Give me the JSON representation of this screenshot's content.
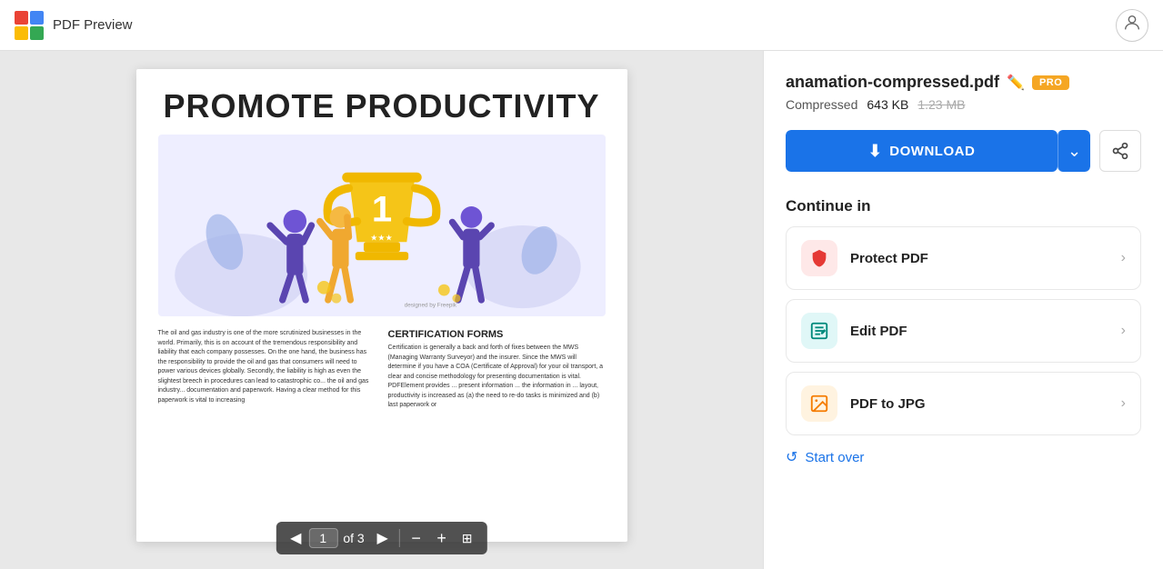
{
  "header": {
    "title": "PDF Preview",
    "logo_cells": [
      "red",
      "blue",
      "yellow",
      "green"
    ]
  },
  "pdf": {
    "title": "PROMOTE PRODUCTIVITY",
    "body_left": "The oil and gas industry is one of the more scrutinized businesses in the world. Primarily, this is on account of the tremendous responsibility and liability that each company possesses. On the one hand, the business has the responsibility to provide the oil and gas that consumers will need to power various devices globally. Secondly, the liability is high as even the slightest breech in procedures can lead to catastrophic co... the oil and gas industry... documentation and paperwork. Having a clear method for this paperwork is vital to increasing",
    "section_title": "CERTIFICATION FORMS",
    "body_right": "Certification is generally a back and forth of fixes between the MWS (Managing Warranty Surveyor) and the insurer. Since the MWS will determine if you have a COA (Certificate of Approval) for your oil transport, a clear and concise methodology for presenting documentation is vital. PDFElement provides ... present information ... the information in ... layout, productivity is increased as (a) the need to re-do tasks is minimized and (b) last paperwork or",
    "current_page": "1",
    "total_pages": "3",
    "of_text": "of 3"
  },
  "sidebar": {
    "file_name": "anamation-compressed.pdf",
    "status": "Compressed",
    "size": "643 KB",
    "original_size": "1.23 MB",
    "pro_badge": "PRO",
    "download_label": "DOWNLOAD",
    "continue_label": "Continue in",
    "tools": [
      {
        "name": "Protect PDF",
        "icon_type": "red",
        "icon": "🛡"
      },
      {
        "name": "Edit PDF",
        "icon_type": "teal",
        "icon": "✏"
      },
      {
        "name": "PDF to JPG",
        "icon_type": "orange",
        "icon": "🖼"
      }
    ],
    "start_over_label": "Start over"
  }
}
